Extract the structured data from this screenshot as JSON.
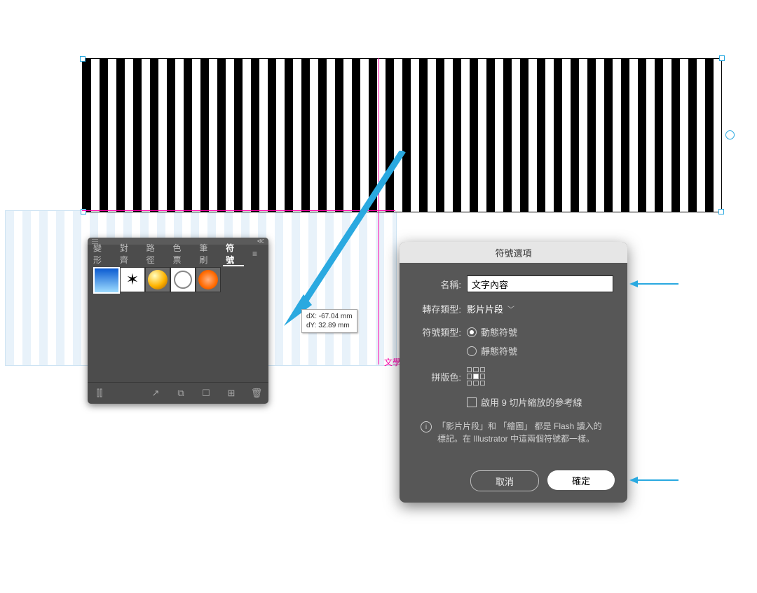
{
  "artwork": {
    "drag_label": "文學",
    "drag_tip_line1": "dX: -67.04 mm",
    "drag_tip_line2": "dY: 32.89 mm"
  },
  "symbols_panel": {
    "title": "符號",
    "tabs": [
      "變形",
      "對齊",
      "路徑",
      "色票",
      "筆刷",
      "符號"
    ],
    "active_tab": 5,
    "swatch_names": [
      "gradient",
      "ink-splat",
      "orb",
      "wireframe",
      "flower"
    ]
  },
  "symbol_options": {
    "title": "符號選項",
    "name_label": "名稱:",
    "name_value": "文字內容",
    "export_type_label": "轉存類型:",
    "export_type_value": "影片片段",
    "symbol_type_label": "符號類型:",
    "symbol_type_options": [
      "動態符號",
      "靜態符號"
    ],
    "symbol_type_selected": 0,
    "registration_label": "拼版色:",
    "slice_checkbox": "啟用 9 切片縮放的參考線",
    "info_text": "「影片片段」和 「繪圖」 都是 Flash 讀入的標記。在 Illustrator 中這兩個符號都一樣。",
    "cancel": "取消",
    "ok": "確定"
  }
}
